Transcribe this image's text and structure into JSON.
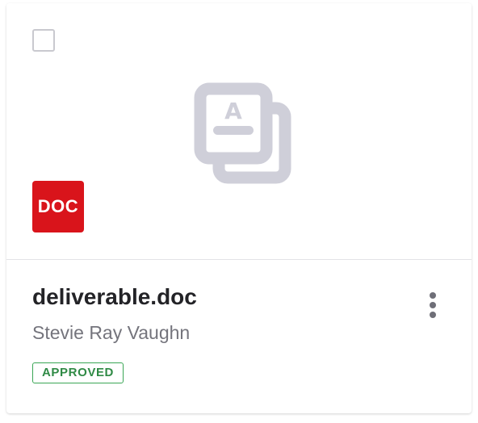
{
  "card": {
    "preview": {
      "placeholder_icon": "file-copy-icon",
      "type_badge": "DOC",
      "type_badge_color": "#d9141b"
    },
    "file_name": "deliverable.doc",
    "author": "Stevie Ray Vaughn",
    "status": "APPROVED",
    "status_color": "#3aa655",
    "menu_icon": "more-vertical-icon"
  }
}
